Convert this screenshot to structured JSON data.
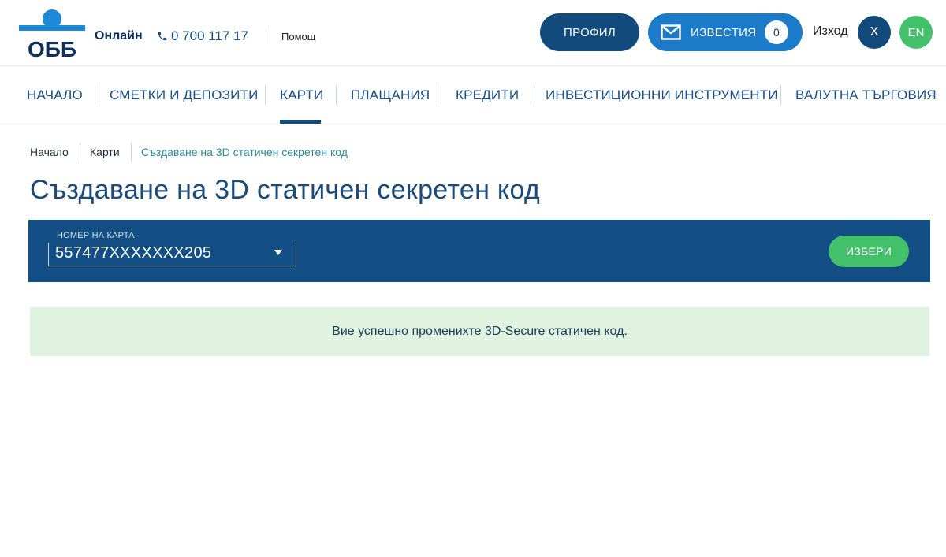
{
  "header": {
    "logo_text": "ОББ",
    "online_label": "Онлайн",
    "phone": "0 700 117 17",
    "help_label": "Помощ",
    "profile_label": "ПРОФИЛ",
    "notifications_label": "ИЗВЕСТИЯ",
    "notifications_count": "0",
    "logout_label": "Изход",
    "close_label": "X",
    "language_label": "EN"
  },
  "nav": {
    "items": [
      {
        "label": "НАЧАЛО"
      },
      {
        "label": "СМЕТКИ И ДЕПОЗИТИ"
      },
      {
        "label": "КАРТИ"
      },
      {
        "label": "ПЛАЩАНИЯ"
      },
      {
        "label": "КРЕДИТИ"
      },
      {
        "label": "ИНВЕСТИЦИОННИ ИНСТРУМЕНТИ"
      },
      {
        "label": "ВАЛУТНА ТЪРГОВИЯ"
      }
    ],
    "active": "КАРТИ"
  },
  "breadcrumb": {
    "items": [
      "Начало",
      "Карти",
      "Създаване на 3D статичен секретен код"
    ]
  },
  "page": {
    "title": "Създаване на 3D статичен секретен код"
  },
  "card_selector": {
    "label": "НОМЕР НА КАРТА",
    "value": "557477XXXXXXX205",
    "button_label": "ИЗБЕРИ"
  },
  "message": {
    "text": "Вие успешно променихте 3D-Secure статичен код."
  },
  "colors": {
    "primary": "#134a7c",
    "accent_blue": "#1c7bc8",
    "green": "#43c06a",
    "success_bg": "#e0f3e0"
  }
}
